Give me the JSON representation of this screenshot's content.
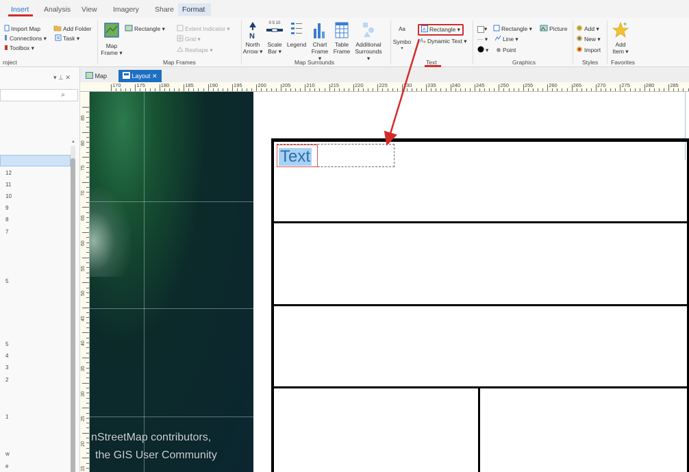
{
  "ribbon": {
    "tabs": [
      {
        "label": "Insert"
      },
      {
        "label": "Analysis"
      },
      {
        "label": "View"
      },
      {
        "label": "Imagery"
      },
      {
        "label": "Share"
      },
      {
        "label": "Format"
      }
    ],
    "active_tab": "Insert",
    "project_group": {
      "import_map": "Import Map",
      "add_folder": "Add Folder",
      "connections": "Connections ▾",
      "task": "Task ▾",
      "toolbox": "Toolbox ▾",
      "label": "roject"
    },
    "map_frames_group": {
      "map_frame_line1": "Map",
      "map_frame_line2": "Frame ▾",
      "rectangle": "Rectangle ▾",
      "extent_indicator": "Extent Indicator ▾",
      "grid": "Grid ▾",
      "reshape": "Reshape ▾",
      "label": "Map Frames"
    },
    "map_surrounds_group": {
      "north_arrow_line1": "North",
      "north_arrow_line2": "Arrow ▾",
      "scale_bar_line1": "Scale",
      "scale_bar_line2": "Bar ▾",
      "scale_bar_numbers": "0 5 10",
      "legend": "Legend",
      "chart_frame_line1": "Chart",
      "chart_frame_line2": "Frame ▾",
      "table_frame_line1": "Table",
      "table_frame_line2": "Frame",
      "additional_surrounds_line1": "Additional",
      "additional_surrounds_line2": "Surrounds ▾",
      "label": "Map Surrounds"
    },
    "text_group": {
      "symbol_top": "Aa",
      "symbol": "Symbo",
      "rectangle": "Rectangle ▾",
      "dynamic_text": "Dynamic Text ▾",
      "label": "Text"
    },
    "graphics_group": {
      "rectangle": "Rectangle ▾",
      "picture": "Picture",
      "line": "Line ▾",
      "point": "Point",
      "label": "Graphics"
    },
    "styles_group": {
      "add": "Add ▾",
      "new": "New ▾",
      "import": "Import",
      "label": "Styles"
    },
    "favorites_group": {
      "add_item_line1": "Add",
      "add_item_line2": "Item ▾",
      "label": "Favorites"
    }
  },
  "left_panel": {
    "pin": "▾ ⊥ ✕",
    "search_icon": "⌕",
    "list_numbers": [
      "12",
      "11",
      "10",
      "9",
      "8",
      "7",
      "5",
      "5",
      "4",
      "3",
      "2",
      "1",
      "w",
      "e"
    ]
  },
  "view_tabs": {
    "map": "Map",
    "layout": "Layout ✕"
  },
  "ruler": {
    "horizontal_labels": [
      "170",
      "175",
      "180",
      "185",
      "190",
      "195",
      "200",
      "205",
      "210",
      "215",
      "220",
      "225",
      "230",
      "235",
      "240",
      "245",
      "250",
      "255",
      "260",
      "265",
      "270",
      "275",
      "280",
      "285"
    ],
    "vertical_labels": [
      "85",
      "80",
      "75",
      "70",
      "65",
      "60",
      "55",
      "50",
      "45",
      "40",
      "35",
      "30",
      "25",
      "20",
      "15"
    ]
  },
  "map_frame": {
    "attribution_line1": "nStreetMap contributors,",
    "attribution_line2": "the GIS User Community"
  },
  "layout": {
    "text_element": "Text"
  },
  "colors": {
    "accent": "#1d6fc2",
    "highlight_red": "#d52a2a",
    "map_dark": "#0b2630",
    "selection_blue": "#a9d1f5"
  }
}
